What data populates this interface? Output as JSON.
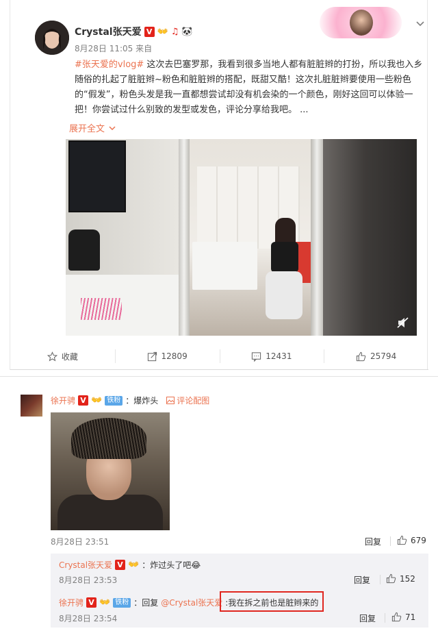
{
  "post": {
    "username": "Crystal张天爱",
    "timestamp": "8月28日 11:05",
    "source": "来自",
    "hashtag": "#张天爱的vlog#",
    "text": " 这次去巴塞罗那，我看到很多当地人都有脏脏辫的打扮，所以我也入乡随俗的扎起了脏脏辫~粉色和脏脏辫的搭配，既甜又酷！这次扎脏脏辫要使用一些粉色的“假发”，粉色头发是我一直都想尝试却没有机会染的一个颜色，刚好这回可以体验一把！你尝试过什么别致的发型或发色，评论分享给我吧。 ...",
    "expand_label": "展开全文",
    "badge_v": "V",
    "actions": {
      "favorite_label": "收藏",
      "repost_count": "12809",
      "comment_count": "12431",
      "like_count": "25794"
    }
  },
  "comments": [
    {
      "username": "徐开骋",
      "badge_v": "V",
      "fan_badge": "铁粉",
      "text": "：爆炸头",
      "pic_link": "评论配图",
      "timestamp": "8月28日 23:51",
      "reply_label": "回复",
      "like_count": "679",
      "replies": [
        {
          "username": "Crystal张天爱",
          "badge_v": "V",
          "text": "：炸过头了吧😂",
          "timestamp": "8月28日 23:53",
          "reply_label": "回复",
          "like_count": "152"
        },
        {
          "username": "徐开骋",
          "badge_v": "V",
          "fan_badge": "铁粉",
          "text_prefix": "：回复",
          "mention": "@Crystal张天爱",
          "text": ":我在拆之前也是脏辫来的",
          "timestamp": "8月28日 23:54",
          "reply_label": "回复",
          "like_count": "71"
        }
      ]
    }
  ],
  "colors": {
    "link": "#eb7350",
    "v_badge": "#e2231a",
    "fan_badge": "#5aa6e8",
    "highlight": "#e0261f"
  },
  "icons": [
    "dropdown-chevron-icon",
    "mute-icon",
    "star-icon",
    "repost-icon",
    "comment-icon",
    "thumbs-up-icon",
    "image-icon"
  ]
}
